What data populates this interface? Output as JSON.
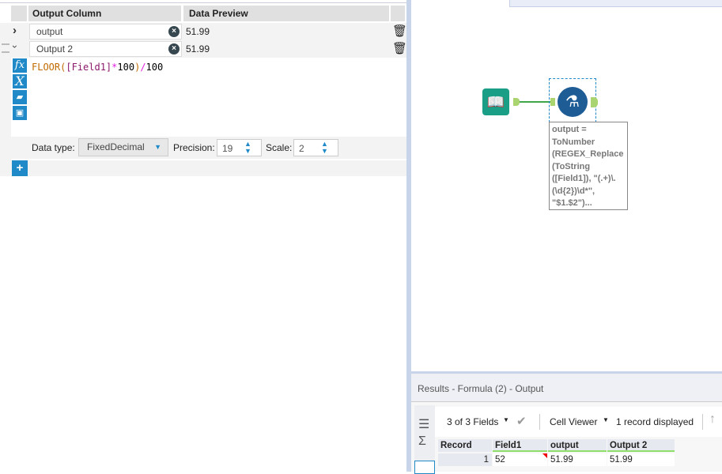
{
  "formula_panel": {
    "headers": {
      "output_column": "Output Column",
      "data_preview": "Data Preview"
    },
    "rows": [
      {
        "name": "output",
        "preview": "51.99",
        "expanded": false
      },
      {
        "name": "Output 2",
        "preview": "51.99",
        "expanded": true
      }
    ],
    "expression": {
      "func": "FLOOR(",
      "field": "[Field1]",
      "op1": "*",
      "num1": "100",
      "close": ")",
      "op2": "/",
      "num2": "100"
    },
    "data_type_label": "Data type:",
    "data_type": "FixedDecimal",
    "precision_label": "Precision:",
    "precision": "19",
    "scale_label": "Scale:",
    "scale": "2",
    "add_label": "+"
  },
  "canvas": {
    "annotation": "output = ToNumber (REGEX_Replace (ToString ([Field1]), \"(.+)\\.(\\d{2})\\d*\", \"$1.$2\")..."
  },
  "results": {
    "title": "Results - Formula (2) - Output",
    "fields_selector": "3 of 3 Fields",
    "cell_viewer": "Cell Viewer",
    "records_status": "1 record displayed",
    "columns": [
      "Record",
      "Field1",
      "output",
      "Output 2"
    ],
    "rows": [
      [
        "1",
        "52",
        "51.99",
        "51.99"
      ]
    ]
  }
}
